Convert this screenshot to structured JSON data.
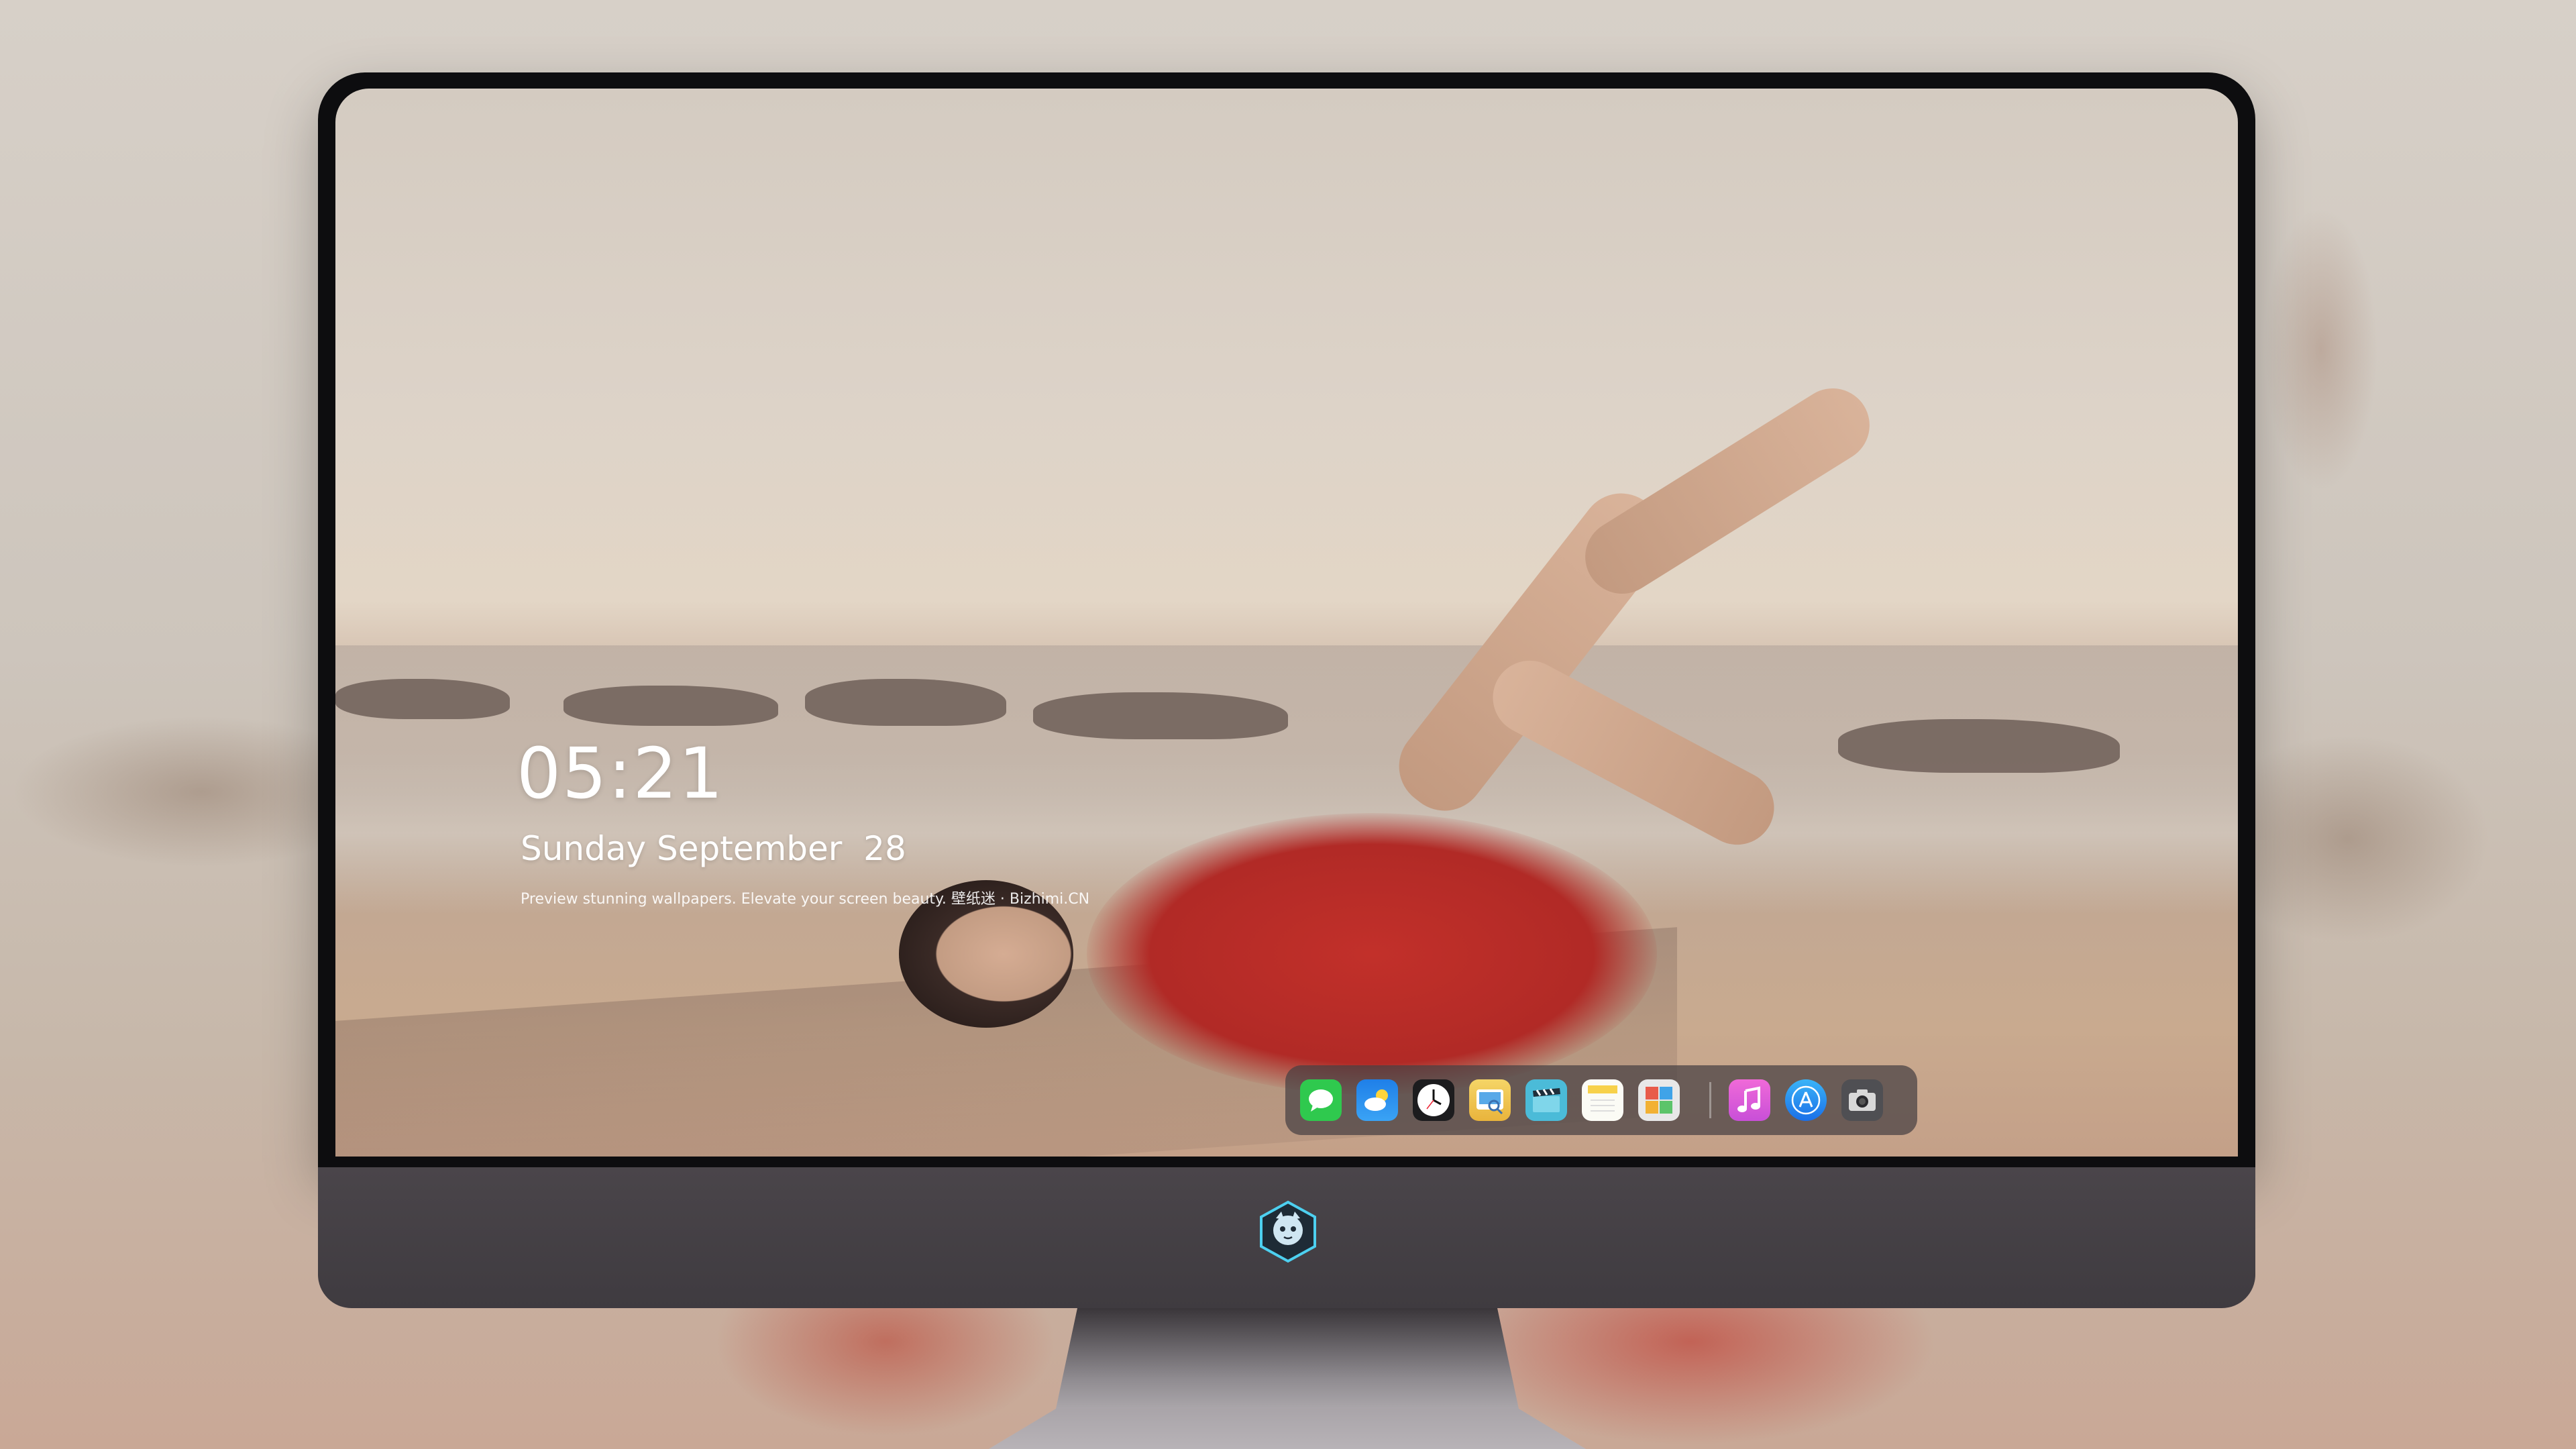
{
  "lockscreen": {
    "time": "05:21",
    "date": "Sunday September  28",
    "tagline": "Preview stunning wallpapers. Elevate your screen beauty. 壁纸迷 · Bizhimi.CN"
  },
  "dock": {
    "apps": [
      {
        "name": "messages",
        "icon": "speech-bubble-icon",
        "color": "#2fc94e"
      },
      {
        "name": "weather",
        "icon": "cloud-sun-icon",
        "color": "#2d8cf0"
      },
      {
        "name": "clock",
        "icon": "clock-icon",
        "color": "#1c1c1e"
      },
      {
        "name": "preview",
        "icon": "image-viewer-icon",
        "color": "#f1c232"
      },
      {
        "name": "videos",
        "icon": "clapperboard-icon",
        "color": "#4bbbd8"
      },
      {
        "name": "notes",
        "icon": "notepad-icon",
        "color": "#f7d14a"
      },
      {
        "name": "photo-booth",
        "icon": "photos-grid-icon",
        "color": "#e8e8e8"
      },
      {
        "name": "music",
        "icon": "music-note-icon",
        "color": "#e14cc6"
      },
      {
        "name": "app-store",
        "icon": "app-store-icon",
        "color": "#1e8cf2"
      },
      {
        "name": "camera",
        "icon": "camera-icon",
        "color": "#5a5a5e"
      }
    ]
  },
  "colors": {
    "bezel": "#0d0d0f",
    "chin": "#433e43",
    "text": "#ffffff"
  }
}
